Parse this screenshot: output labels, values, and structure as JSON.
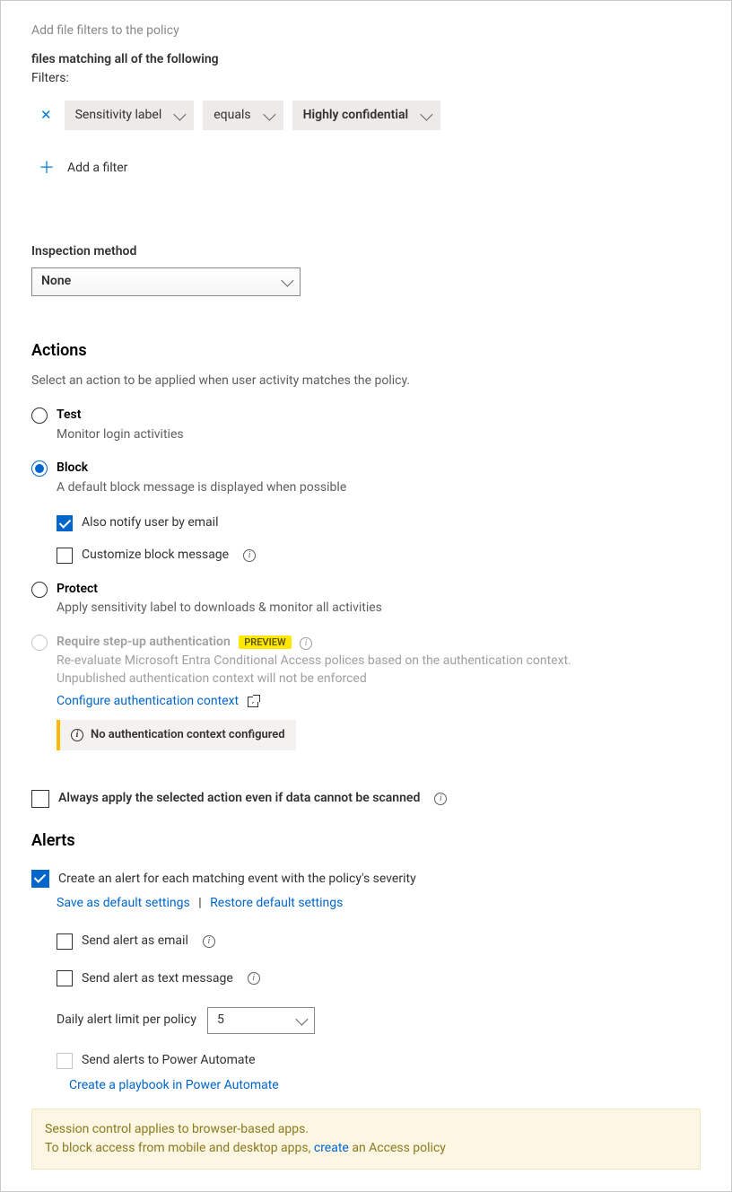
{
  "filtersSection": {
    "intro": "Add file filters to the policy",
    "matching": "files matching all of the following",
    "filtersLabel": "Filters:",
    "filter": {
      "field": "Sensitivity label",
      "operator": "equals",
      "value": "Highly confidential"
    },
    "addFilter": "Add a filter"
  },
  "inspection": {
    "label": "Inspection method",
    "value": "None"
  },
  "actions": {
    "heading": "Actions",
    "intro": "Select an action to be applied when user activity matches the policy.",
    "test": {
      "title": "Test",
      "sub": "Monitor login activities"
    },
    "block": {
      "title": "Block",
      "sub": "A default block message is displayed when possible",
      "notifyEmail": "Also notify user by email",
      "customize": "Customize block message"
    },
    "protect": {
      "title": "Protect",
      "sub": "Apply sensitivity label to downloads & monitor all activities"
    },
    "stepup": {
      "title": "Require step-up authentication",
      "preview": "PREVIEW",
      "sub": "Re-evaluate Microsoft Entra Conditional Access polices based on the authentication context. Unpublished authentication context will not be enforced",
      "configureLink": "Configure authentication context",
      "warn": "No authentication context configured"
    },
    "alwaysApply": "Always apply the selected action even if data cannot be scanned"
  },
  "alerts": {
    "heading": "Alerts",
    "createAlert": "Create an alert for each matching event with the policy's severity",
    "saveDefault": "Save as default settings",
    "restoreDefault": "Restore default settings",
    "sendEmail": "Send alert as email",
    "sendText": "Send alert as text message",
    "dailyLimitLabel": "Daily alert limit per policy",
    "dailyLimitValue": "5",
    "powerAutomate": "Send alerts to Power Automate",
    "playbookLink": "Create a playbook in Power Automate"
  },
  "footer": {
    "line1": "Session control applies to browser-based apps.",
    "line2a": "To block access from mobile and desktop apps, ",
    "createLink": "create",
    "line2b": " an Access policy"
  }
}
